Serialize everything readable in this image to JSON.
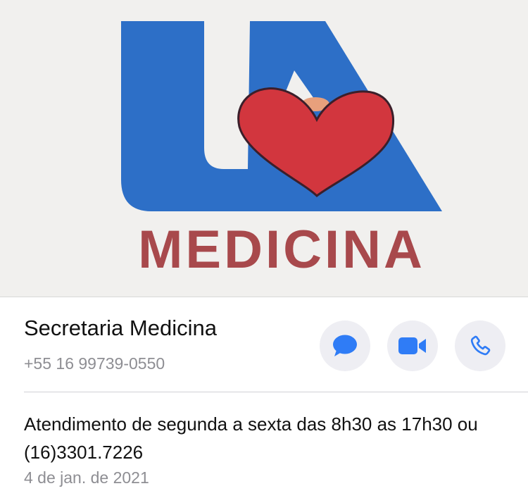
{
  "profile": {
    "photo": {
      "logo_text": "UA",
      "caption": "MEDICINA"
    },
    "name": "Secretaria Medicina",
    "phone": "+55 16 99739-0550"
  },
  "actions": [
    {
      "name": "message",
      "icon": "message-bubble-icon"
    },
    {
      "name": "video",
      "icon": "video-camera-icon"
    },
    {
      "name": "call",
      "icon": "phone-icon"
    }
  ],
  "about": {
    "text": "Atendimento de segunda a sexta das 8h30 as 17h30 ou (16)3301.7226",
    "date": "4 de jan. de 2021"
  },
  "colors": {
    "accent": "#2f7cf6",
    "logo_blue": "#2d6fc7",
    "logo_red": "#d2363e",
    "caption_red": "#a8494c",
    "button_bg": "#eeeef3",
    "secondary_text": "#8e8e93"
  }
}
